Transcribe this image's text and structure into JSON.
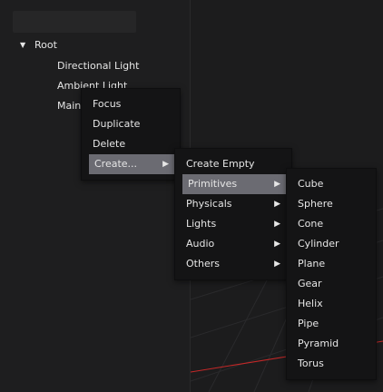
{
  "hierarchy": {
    "tree": {
      "root": {
        "label": "Root",
        "toggle": "▼"
      },
      "children": [
        {
          "label": "Directional Light"
        },
        {
          "label": "Ambient Light"
        },
        {
          "label": "Main"
        }
      ]
    }
  },
  "context_menu": {
    "items": [
      {
        "label": "Focus"
      },
      {
        "label": "Duplicate"
      },
      {
        "label": "Delete"
      },
      {
        "label": "Create...",
        "arrow": "▶"
      }
    ]
  },
  "create_menu": {
    "items": [
      {
        "label": "Create Empty"
      },
      {
        "label": "Primitives",
        "arrow": "▶"
      },
      {
        "label": "Physicals",
        "arrow": "▶"
      },
      {
        "label": "Lights",
        "arrow": "▶"
      },
      {
        "label": "Audio",
        "arrow": "▶"
      },
      {
        "label": "Others",
        "arrow": "▶"
      }
    ]
  },
  "primitives_menu": {
    "items": [
      {
        "label": "Cube"
      },
      {
        "label": "Sphere"
      },
      {
        "label": "Cone"
      },
      {
        "label": "Cylinder"
      },
      {
        "label": "Plane"
      },
      {
        "label": "Gear"
      },
      {
        "label": "Helix"
      },
      {
        "label": "Pipe"
      },
      {
        "label": "Pyramid"
      },
      {
        "label": "Torus"
      }
    ]
  },
  "colors": {
    "highlight": "#6b6b72",
    "menu_bg": "#141415",
    "axis_red": "#c62828"
  }
}
